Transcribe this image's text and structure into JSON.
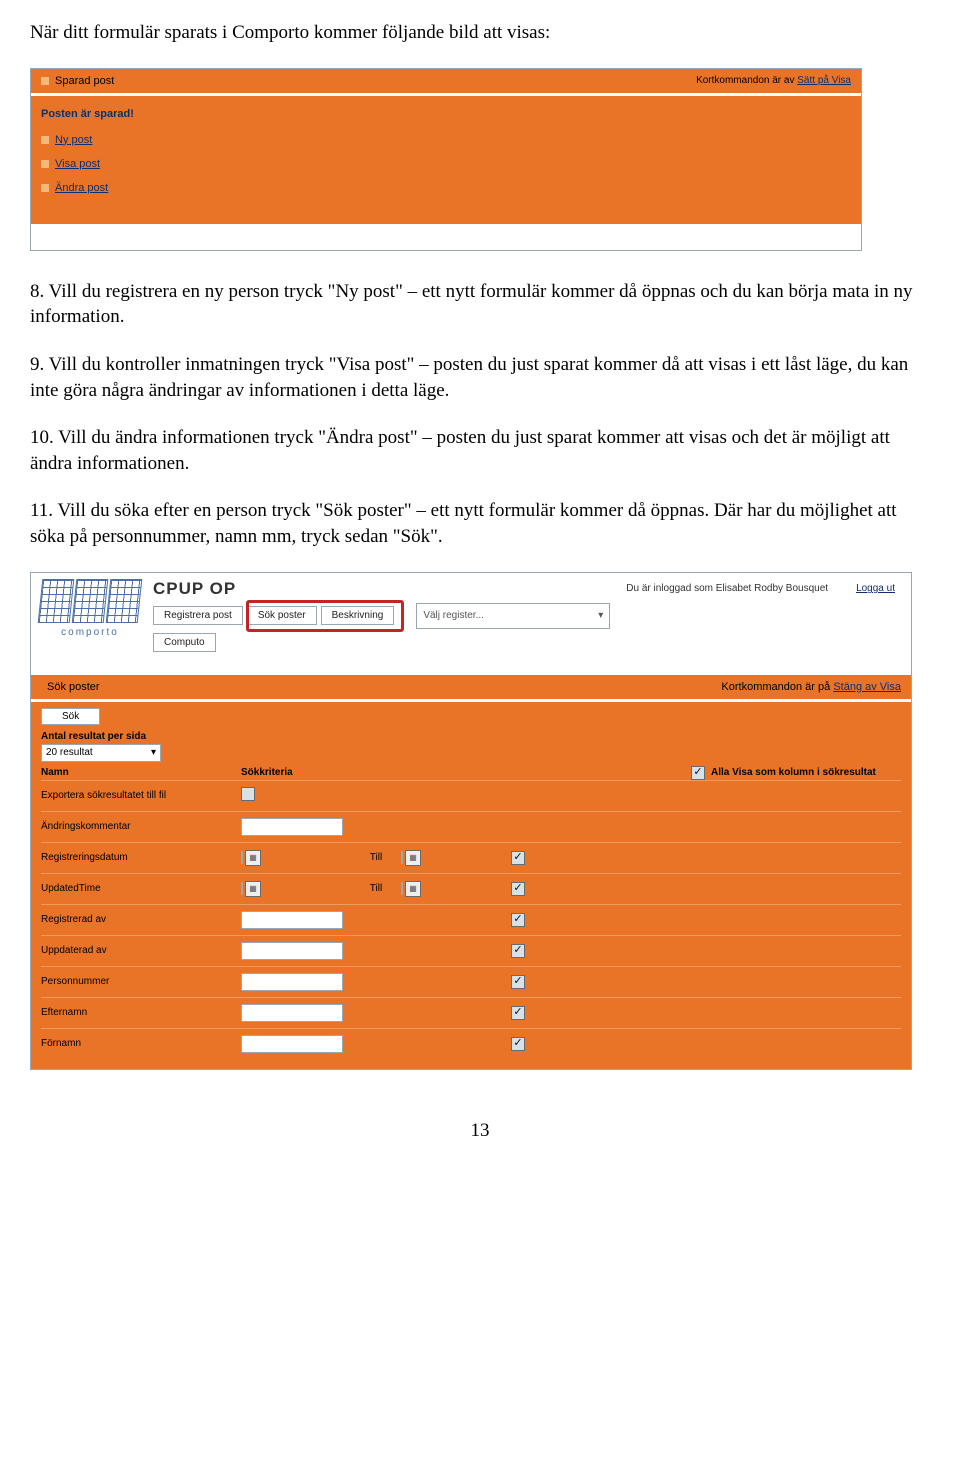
{
  "intro": "När ditt formulär sparats i Comporto kommer följande bild att visas:",
  "shot1": {
    "title": "Sparad post",
    "kortkom_prefix": "Kortkommandon är av ",
    "kortkom_link": "Sätt på Visa",
    "saved_msg": "Posten är sparad!",
    "links": [
      "Ny post",
      "Visa post",
      "Ändra post"
    ]
  },
  "paras": {
    "p8": "8. Vill du registrera en ny person tryck \"Ny post\" – ett nytt formulär kommer då öppnas och du kan börja mata in ny information.",
    "p9": "9. Vill du kontroller inmatningen tryck \"Visa post\" – posten du just sparat kommer då att visas i ett låst läge, du kan inte göra några ändringar av informationen i detta läge.",
    "p10": "10. Vill du ändra informationen tryck \"Ändra post\" – posten du just sparat kommer att visas och det är möjligt att ändra informationen.",
    "p11": "11. Vill du söka efter en person tryck \"Sök poster\" – ett nytt formulär kommer då öppnas. Där har du möjlighet att söka på personnummer, namn mm, tryck sedan \"Sök\"."
  },
  "shot2": {
    "logo_text": "comporto",
    "app_title": "CPUP OP",
    "logged_in": "Du är inloggad som Elisabet Rodby Bousquet",
    "logout": "Logga ut",
    "nav": [
      "Registrera post",
      "Sök poster",
      "Beskrivning"
    ],
    "nav2": "Computo",
    "register_placeholder": "Välj register...",
    "panel_title": "Sök poster",
    "kortkom_prefix": "Kortkommandon är på ",
    "kortkom_link": "Stäng av Visa",
    "sok_btn": "Sök",
    "results_per_page_label": "Antal resultat per sida",
    "results_per_page_value": "20 resultat",
    "col_name": "Namn",
    "col_criteria": "Sökkriteria",
    "col_all_visa": "Alla Visa som kolumn i sökresultat",
    "till": "Till",
    "rows": [
      {
        "label": "Exportera sökresultatet till fil",
        "type": "checkbox",
        "checked": false
      },
      {
        "label": "Ändringskommentar",
        "type": "text"
      },
      {
        "label": "Registreringsdatum",
        "type": "daterange",
        "checked": true
      },
      {
        "label": "UpdatedTime",
        "type": "daterange",
        "checked": true
      },
      {
        "label": "Registrerad av",
        "type": "text",
        "checked": true
      },
      {
        "label": "Uppdaterad av",
        "type": "text",
        "checked": true
      },
      {
        "label": "Personnummer",
        "type": "text",
        "checked": true
      },
      {
        "label": "Efternamn",
        "type": "text",
        "checked": true
      },
      {
        "label": "Förnamn",
        "type": "text",
        "checked": true
      }
    ]
  },
  "page_number": "13"
}
